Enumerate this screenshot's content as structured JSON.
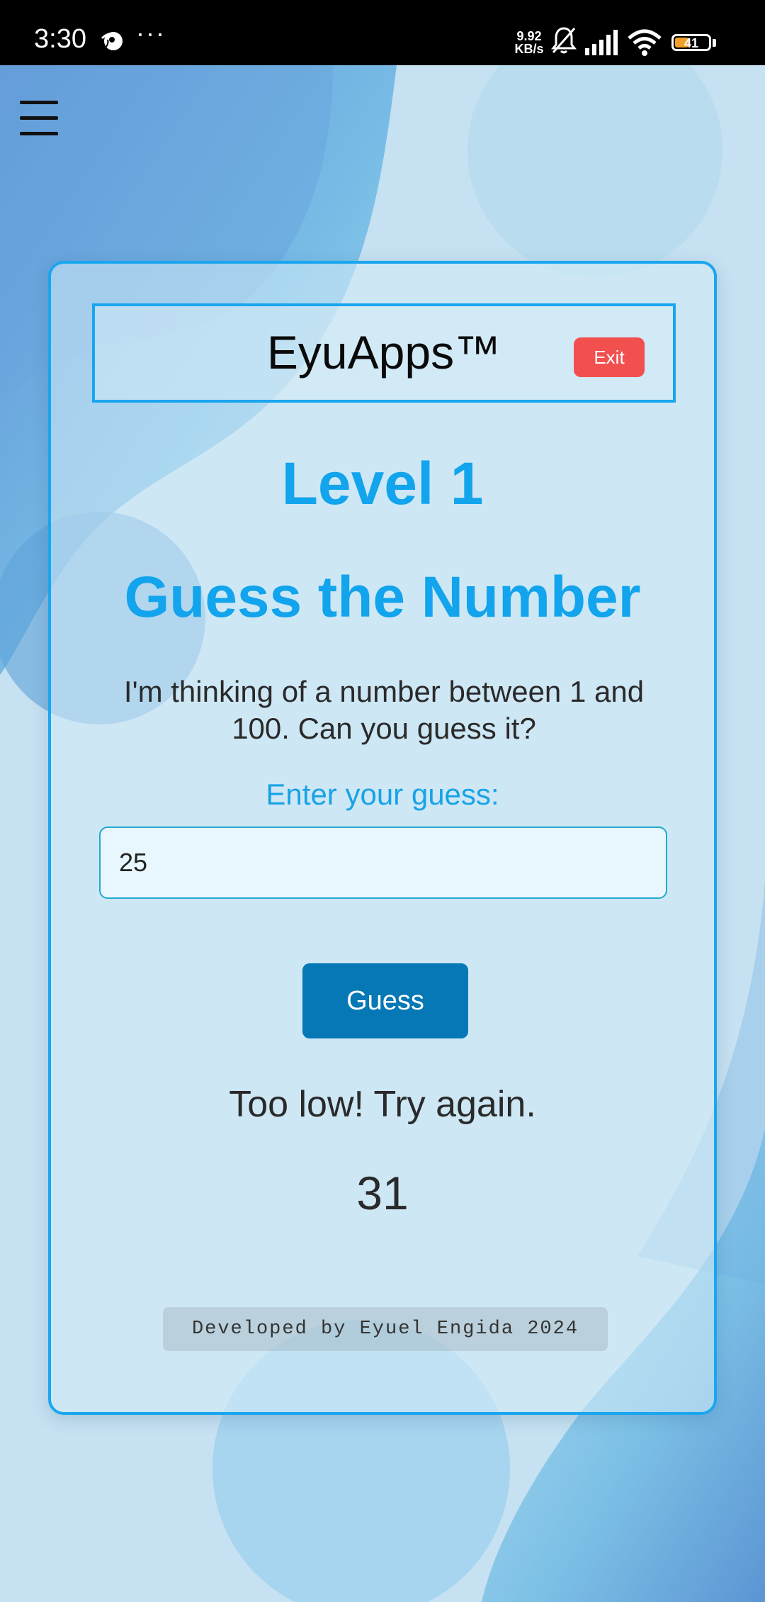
{
  "status_bar": {
    "time": "3:30",
    "more": "···",
    "net_speed_value": "9.92",
    "net_speed_unit": "KB/s",
    "battery_level": "41",
    "battery_fraction": 0.41,
    "icons": [
      "app-notification-icon",
      "mute-icon",
      "signal-icon",
      "wifi-icon",
      "battery-icon"
    ]
  },
  "menu": {
    "icon": "hamburger-menu-icon"
  },
  "header": {
    "brand": "EyuApps™",
    "exit_label": "Exit"
  },
  "game": {
    "level": "Level 1",
    "title": "Guess the Number",
    "intro": "I'm thinking of a number between 1 and 100. Can you guess it?",
    "input_label": "Enter your guess:",
    "input_value": "25",
    "guess_button_label": "Guess",
    "feedback": "Too low! Try again.",
    "counter": "31"
  },
  "footer": {
    "credit": "Developed by Eyuel Engida 2024"
  },
  "colors": {
    "accent": "#1aa6ef",
    "title_blue": "#12a4ec",
    "exit_red": "#f24f4f",
    "guess_button": "#0578b5",
    "background_light": "#c9e2f2",
    "background_dark": "#5b95d3"
  }
}
